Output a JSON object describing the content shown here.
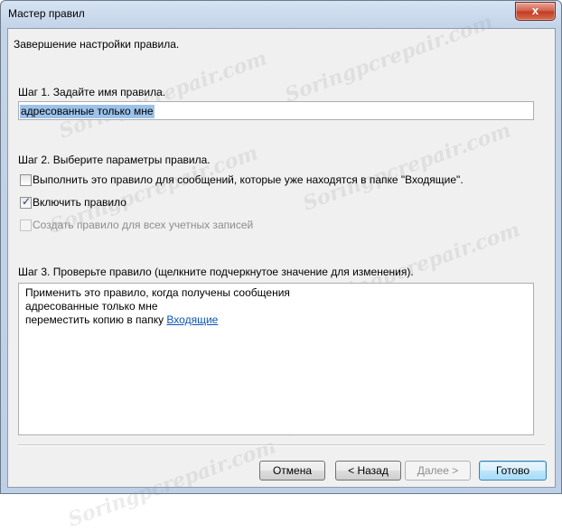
{
  "window": {
    "title": "Мастер правил",
    "close_glyph": "x"
  },
  "heading": "Завершение настройки правила.",
  "step1": {
    "label": "Шаг 1. Задайте имя правила.",
    "rule_name_value": "адресованные только мне"
  },
  "step2": {
    "label": "Шаг 2. Выберите параметры правила.",
    "options": [
      {
        "label": "Выполнить это правило для сообщений, которые уже находятся в папке \"Входящие\".",
        "checked": false,
        "enabled": true
      },
      {
        "label": "Включить правило",
        "checked": true,
        "enabled": true
      },
      {
        "label": "Создать правило для всех учетных записей",
        "checked": false,
        "enabled": false
      }
    ]
  },
  "step3": {
    "label": "Шаг 3. Проверьте правило (щелкните подчеркнутое значение для изменения).",
    "lines": [
      "Применить это правило, когда получены сообщения",
      "адресованные только мне"
    ],
    "action_prefix": "переместить копию в папку ",
    "action_link": "Входящие"
  },
  "buttons": {
    "cancel": "Отмена",
    "back": "< Назад",
    "next": "Далее >",
    "finish": "Готово"
  },
  "watermark_text": "Soringpcrepair.com",
  "colors": {
    "selection": "#9cc2e9",
    "link": "#0b56b5",
    "close_button": "#c13b24"
  }
}
